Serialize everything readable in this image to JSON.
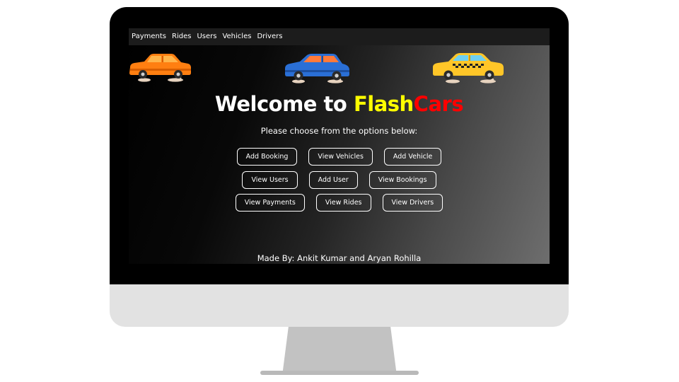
{
  "menu": {
    "items": [
      "Payments",
      "Rides",
      "Users",
      "Vehicles",
      "Drivers"
    ]
  },
  "colors": {
    "flash": "#ffff00",
    "cars": "#ff0000",
    "car_orange": "#ff7f11",
    "car_blue": "#2a6fd6",
    "car_taxi": "#ffc628"
  },
  "illustrations": [
    "orange-car-icon",
    "blue-car-icon",
    "taxi-car-icon"
  ],
  "header": {
    "title_prefix": "Welcome to ",
    "title_flash": "Flash",
    "title_cars": "Cars",
    "subtitle": "Please choose from the options below:"
  },
  "buttons": {
    "row1": [
      "Add Booking",
      "View Vehicles",
      "Add Vehicle"
    ],
    "row2": [
      "View Users",
      "Add User",
      "View Bookings"
    ],
    "row3": [
      "View Payments",
      "View Rides",
      "View Drivers"
    ]
  },
  "footer": {
    "credit": "Made By: Ankit Kumar and Aryan Rohilla"
  }
}
